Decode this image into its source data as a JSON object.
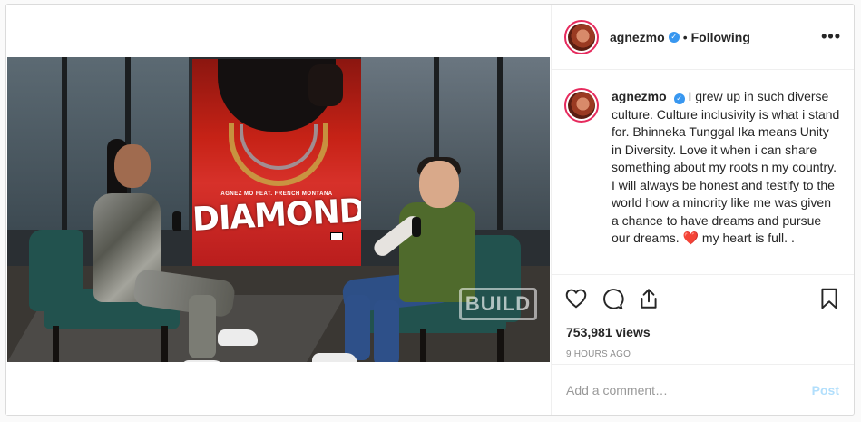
{
  "post": {
    "username": "agnezmo",
    "follow_status": "Following",
    "more_label": "•••",
    "separator": "•",
    "caption_lines": [
      "I grew up in such diverse culture. Culture inclusivity is what i stand for. Bhinneka Tunggal Ika means Unity in Diversity. Love it when i can share something about my roots n my country.",
      "I will always be honest and testify to the world how a minority like me was given a chance to have dreams and pursue our dreams.",
      "my heart is full. ."
    ],
    "caption_heart": "❤️",
    "views": "753,981 views",
    "time_ago": "9 HOURS AGO"
  },
  "video": {
    "poster_artist": "AGNEZ MO FEAT. FRENCH MONTANA",
    "poster_title": "DIAMONDS",
    "logo_bug": "BUILD"
  },
  "comment": {
    "placeholder": "Add a comment…",
    "post_label": "Post"
  },
  "icons": {
    "like": "heart-icon",
    "comment": "comment-icon",
    "share": "share-icon",
    "save": "bookmark-icon",
    "verified": "verified-badge-icon",
    "more": "more-options-icon"
  },
  "colors": {
    "verified_blue": "#3897f0",
    "post_button_disabled": "#b2dffc",
    "story_ring": "#e62a5d",
    "muted_text": "#8e8e8e"
  }
}
